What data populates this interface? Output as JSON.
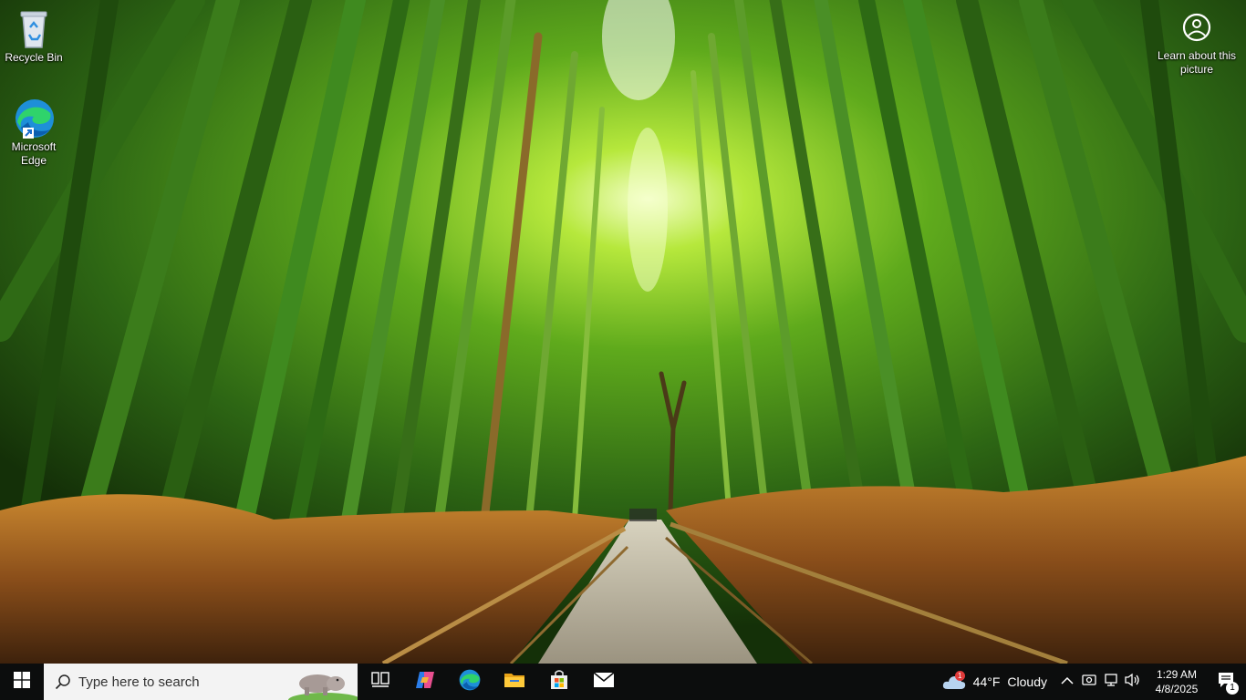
{
  "desktop": {
    "icons": [
      {
        "label": "Recycle Bin",
        "icon": "recycle-bin-icon"
      },
      {
        "label": "Microsoft Edge",
        "icon": "edge-icon"
      }
    ],
    "spotlight": {
      "label": "Learn about this picture",
      "icon": "camera-info-icon"
    }
  },
  "taskbar": {
    "search": {
      "placeholder": "Type here to search"
    },
    "apps": [
      {
        "name": "Task View",
        "icon": "task-view-icon"
      },
      {
        "name": "Copilot",
        "icon": "copilot-icon"
      },
      {
        "name": "Microsoft Edge",
        "icon": "edge-icon"
      },
      {
        "name": "File Explorer",
        "icon": "folder-icon"
      },
      {
        "name": "Microsoft Store",
        "icon": "store-icon"
      },
      {
        "name": "Mail",
        "icon": "mail-icon"
      }
    ],
    "weather": {
      "temp": "44°F",
      "condition": "Cloudy",
      "alert_count": "1"
    },
    "clock": {
      "time": "1:29 AM",
      "date": "4/8/2025"
    },
    "notifications": {
      "count": "1"
    }
  },
  "colors": {
    "taskbar": "#0c0d0d",
    "accent": "#76b9ed",
    "search_bg": "#f3f3f3"
  }
}
